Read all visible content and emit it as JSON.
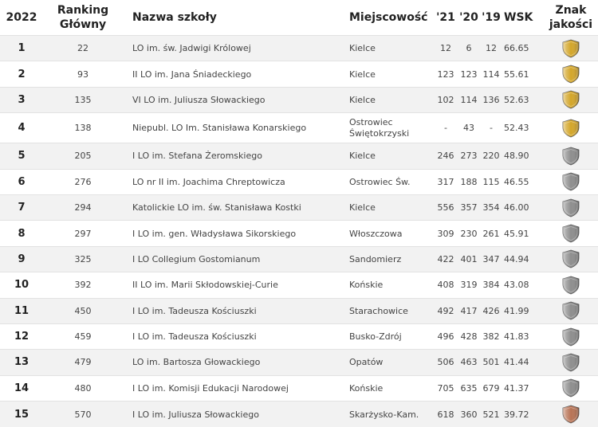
{
  "header": {
    "year": "2022",
    "ranking_line1": "Ranking",
    "ranking_line2": "Główny",
    "name": "Nazwa szkoły",
    "city": "Miejscowość",
    "y21": "'21",
    "y20": "'20",
    "y19": "'19",
    "wsk": "WSK",
    "badge_line1": "Znak",
    "badge_line2": "jakości"
  },
  "colors": {
    "gold": "#d4a62a",
    "silver": "#8e8e8e",
    "bronze": "#b87355"
  },
  "rows": [
    {
      "pos": "1",
      "rank": "22",
      "name": "LO im. św. Jadwigi Królowej",
      "city": "Kielce",
      "y21": "12",
      "y20": "6",
      "y19": "12",
      "wsk": "66.65",
      "badge": "gold"
    },
    {
      "pos": "2",
      "rank": "93",
      "name": "II LO im. Jana Śniadeckiego",
      "city": "Kielce",
      "y21": "123",
      "y20": "123",
      "y19": "114",
      "wsk": "55.61",
      "badge": "gold"
    },
    {
      "pos": "3",
      "rank": "135",
      "name": "VI LO im. Juliusza Słowackiego",
      "city": "Kielce",
      "y21": "102",
      "y20": "114",
      "y19": "136",
      "wsk": "52.63",
      "badge": "gold"
    },
    {
      "pos": "4",
      "rank": "138",
      "name": "Niepubl. LO Im. Stanisława Konarskiego",
      "city": "Ostrowiec Świętokrzyski",
      "y21": "-",
      "y20": "43",
      "y19": "-",
      "wsk": "52.43",
      "badge": "gold"
    },
    {
      "pos": "5",
      "rank": "205",
      "name": "I LO im. Stefana Żeromskiego",
      "city": "Kielce",
      "y21": "246",
      "y20": "273",
      "y19": "220",
      "wsk": "48.90",
      "badge": "silver"
    },
    {
      "pos": "6",
      "rank": "276",
      "name": "LO nr II im. Joachima Chreptowicza",
      "city": "Ostrowiec Św.",
      "y21": "317",
      "y20": "188",
      "y19": "115",
      "wsk": "46.55",
      "badge": "silver"
    },
    {
      "pos": "7",
      "rank": "294",
      "name": "Katolickie LO im. św. Stanisława Kostki",
      "city": "Kielce",
      "y21": "556",
      "y20": "357",
      "y19": "354",
      "wsk": "46.00",
      "badge": "silver"
    },
    {
      "pos": "8",
      "rank": "297",
      "name": "I LO im. gen. Władysława Sikorskiego",
      "city": "Włoszczowa",
      "y21": "309",
      "y20": "230",
      "y19": "261",
      "wsk": "45.91",
      "badge": "silver"
    },
    {
      "pos": "9",
      "rank": "325",
      "name": "I LO Collegium Gostomianum",
      "city": "Sandomierz",
      "y21": "422",
      "y20": "401",
      "y19": "347",
      "wsk": "44.94",
      "badge": "silver"
    },
    {
      "pos": "10",
      "rank": "392",
      "name": "II LO im. Marii Skłodowskiej-Curie",
      "city": "Końskie",
      "y21": "408",
      "y20": "319",
      "y19": "384",
      "wsk": "43.08",
      "badge": "silver"
    },
    {
      "pos": "11",
      "rank": "450",
      "name": "I LO im. Tadeusza Kościuszki",
      "city": "Starachowice",
      "y21": "492",
      "y20": "417",
      "y19": "426",
      "wsk": "41.99",
      "badge": "silver"
    },
    {
      "pos": "12",
      "rank": "459",
      "name": "I LO im. Tadeusza Kościuszki",
      "city": "Busko-Zdrój",
      "y21": "496",
      "y20": "428",
      "y19": "382",
      "wsk": "41.83",
      "badge": "silver"
    },
    {
      "pos": "13",
      "rank": "479",
      "name": "LO im. Bartosza Głowackiego",
      "city": "Opatów",
      "y21": "506",
      "y20": "463",
      "y19": "501",
      "wsk": "41.44",
      "badge": "silver"
    },
    {
      "pos": "14",
      "rank": "480",
      "name": "I LO im. Komisji Edukacji Narodowej",
      "city": "Końskie",
      "y21": "705",
      "y20": "635",
      "y19": "679",
      "wsk": "41.37",
      "badge": "silver"
    },
    {
      "pos": "15",
      "rank": "570",
      "name": "I LO im. Juliusza Słowackiego",
      "city": "Skarżysko-Kam.",
      "y21": "618",
      "y20": "360",
      "y19": "521",
      "wsk": "39.72",
      "badge": "bronze"
    }
  ]
}
